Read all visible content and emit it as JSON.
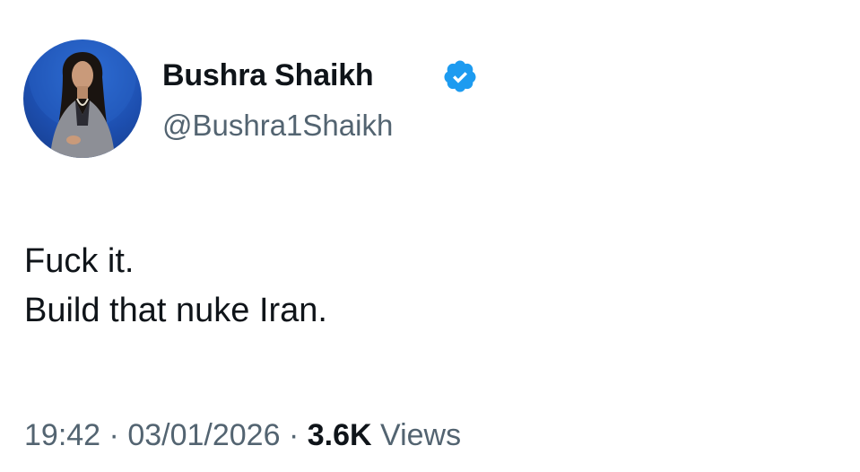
{
  "author": {
    "display_name": "Bushra Shaikh",
    "handle": "@Bushra1Shaikh",
    "verified": true,
    "avatar": "profile-photo-woman"
  },
  "tweet": {
    "lines": [
      "Fuck it.",
      "Build that nuke Iran."
    ]
  },
  "meta": {
    "time": "19:42",
    "separator": "·",
    "date": "03/01/2026",
    "views_count": "3.6K",
    "views_label": "Views"
  },
  "colors": {
    "text_primary": "#0f1419",
    "text_secondary": "#536471",
    "verified_blue": "#1d9bf0",
    "background": "#ffffff"
  }
}
